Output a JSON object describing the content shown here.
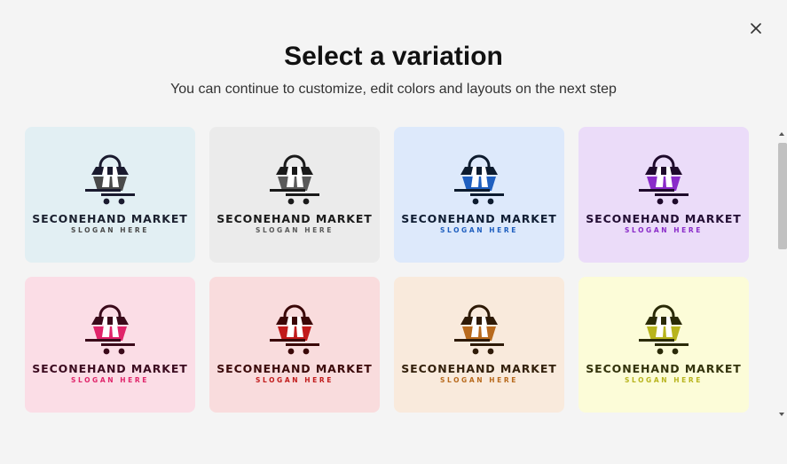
{
  "dialog": {
    "title": "Select a variation",
    "subtitle": "You can continue to customize, edit colors and layouts on the next step",
    "close_icon": "close-icon"
  },
  "variations": [
    {
      "brand": "SECONEHAND MARKET",
      "slogan": "SLOGAN HERE",
      "bg": "#e2eff3",
      "accent": "#4a4a4a",
      "dark": "#1a1a2e",
      "text": "#1a1f2e"
    },
    {
      "brand": "SECONEHAND MARKET",
      "slogan": "SLOGAN HERE",
      "bg": "#ebebeb",
      "accent": "#5a5a5a",
      "dark": "#1a1a1a",
      "text": "#1a1a1a"
    },
    {
      "brand": "SECONEHAND MARKET",
      "slogan": "SLOGAN HERE",
      "bg": "#dde9fb",
      "accent": "#1f5fbf",
      "dark": "#0d1b2e",
      "text": "#0f1d33"
    },
    {
      "brand": "SECONEHAND MARKET",
      "slogan": "SLOGAN HERE",
      "bg": "#ebdcf9",
      "accent": "#8a2bc9",
      "dark": "#1e0a2b",
      "text": "#220d33"
    },
    {
      "brand": "SECONEHAND MARKET",
      "slogan": "SLOGAN HERE",
      "bg": "#fbdde6",
      "accent": "#e0246a",
      "dark": "#3a0a1a",
      "text": "#3b0a1f"
    },
    {
      "brand": "SECONEHAND MARKET",
      "slogan": "SLOGAN HERE",
      "bg": "#f9dcdd",
      "accent": "#c11b1b",
      "dark": "#3a0707",
      "text": "#3b0909"
    },
    {
      "brand": "SECONEHAND MARKET",
      "slogan": "SLOGAN HERE",
      "bg": "#f9eadc",
      "accent": "#b86a1d",
      "dark": "#2e1a07",
      "text": "#33200b"
    },
    {
      "brand": "SECONEHAND MARKET",
      "slogan": "SLOGAN HERE",
      "bg": "#fcfcd8",
      "accent": "#b8b41d",
      "dark": "#2a2a07",
      "text": "#33330b"
    }
  ]
}
